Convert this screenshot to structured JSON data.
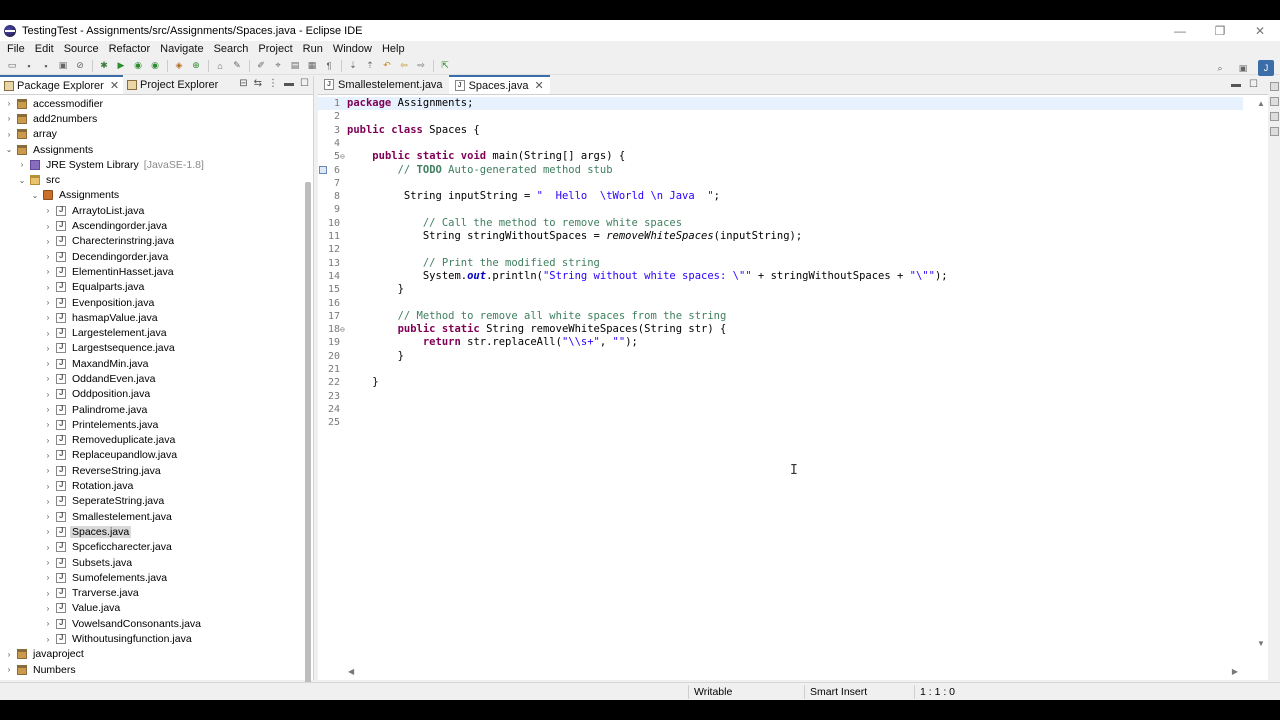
{
  "window": {
    "title": "TestingTest - Assignments/src/Assignments/Spaces.java - Eclipse IDE",
    "controls": {
      "minimize": "—",
      "restore": "❐",
      "close": "✕"
    }
  },
  "menu": [
    "File",
    "Edit",
    "Source",
    "Refactor",
    "Navigate",
    "Search",
    "Project",
    "Run",
    "Window",
    "Help"
  ],
  "left_pane": {
    "tabs": [
      {
        "label": "Package Explorer",
        "active": true
      },
      {
        "label": "Project Explorer",
        "active": false
      }
    ],
    "tree": [
      {
        "label": "accessmodifier",
        "depth": 0,
        "icon": "project-icon",
        "toggle": "›"
      },
      {
        "label": "add2numbers",
        "depth": 0,
        "icon": "project-icon",
        "toggle": "›"
      },
      {
        "label": "array",
        "depth": 0,
        "icon": "project-icon",
        "toggle": "›"
      },
      {
        "label": "Assignments",
        "depth": 0,
        "icon": "project-icon",
        "toggle": "⌄"
      },
      {
        "label": "JRE System Library",
        "extra": "[JavaSE-1.8]",
        "depth": 1,
        "icon": "library-icon",
        "toggle": "›"
      },
      {
        "label": "src",
        "depth": 1,
        "icon": "folder-icon",
        "toggle": "⌄"
      },
      {
        "label": "Assignments",
        "depth": 2,
        "icon": "package-icon",
        "toggle": "⌄"
      },
      {
        "label": "ArraytoList.java",
        "depth": 3,
        "icon": "java-file-icon",
        "toggle": "›"
      },
      {
        "label": "Ascendingorder.java",
        "depth": 3,
        "icon": "java-file-icon",
        "toggle": "›"
      },
      {
        "label": "Charecterinstring.java",
        "depth": 3,
        "icon": "java-file-icon",
        "toggle": "›"
      },
      {
        "label": "Decendingorder.java",
        "depth": 3,
        "icon": "java-file-icon",
        "toggle": "›"
      },
      {
        "label": "ElementinHasset.java",
        "depth": 3,
        "icon": "java-file-icon",
        "toggle": "›"
      },
      {
        "label": "Equalparts.java",
        "depth": 3,
        "icon": "java-file-icon",
        "toggle": "›"
      },
      {
        "label": "Evenposition.java",
        "depth": 3,
        "icon": "java-file-icon",
        "toggle": "›"
      },
      {
        "label": "hasmapValue.java",
        "depth": 3,
        "icon": "java-file-icon",
        "toggle": "›"
      },
      {
        "label": "Largestelement.java",
        "depth": 3,
        "icon": "java-file-icon",
        "toggle": "›"
      },
      {
        "label": "Largestsequence.java",
        "depth": 3,
        "icon": "java-file-icon",
        "toggle": "›"
      },
      {
        "label": "MaxandMin.java",
        "depth": 3,
        "icon": "java-file-icon",
        "toggle": "›"
      },
      {
        "label": "OddandEven.java",
        "depth": 3,
        "icon": "java-file-icon",
        "toggle": "›"
      },
      {
        "label": "Oddposition.java",
        "depth": 3,
        "icon": "java-file-icon",
        "toggle": "›"
      },
      {
        "label": "Palindrome.java",
        "depth": 3,
        "icon": "java-file-icon",
        "toggle": "›"
      },
      {
        "label": "Printelements.java",
        "depth": 3,
        "icon": "java-file-icon",
        "toggle": "›"
      },
      {
        "label": "Removeduplicate.java",
        "depth": 3,
        "icon": "java-file-icon",
        "toggle": "›"
      },
      {
        "label": "Replaceupandlow.java",
        "depth": 3,
        "icon": "java-file-icon",
        "toggle": "›"
      },
      {
        "label": "ReverseString.java",
        "depth": 3,
        "icon": "java-file-icon",
        "toggle": "›"
      },
      {
        "label": "Rotation.java",
        "depth": 3,
        "icon": "java-file-icon",
        "toggle": "›"
      },
      {
        "label": "SeperateString.java",
        "depth": 3,
        "icon": "java-file-icon",
        "toggle": "›"
      },
      {
        "label": "Smallestelement.java",
        "depth": 3,
        "icon": "java-file-icon",
        "toggle": "›"
      },
      {
        "label": "Spaces.java",
        "depth": 3,
        "icon": "java-file-icon",
        "toggle": "›",
        "selected": true
      },
      {
        "label": "Spceficcharecter.java",
        "depth": 3,
        "icon": "java-file-icon",
        "toggle": "›"
      },
      {
        "label": "Subsets.java",
        "depth": 3,
        "icon": "java-file-icon",
        "toggle": "›"
      },
      {
        "label": "Sumofelements.java",
        "depth": 3,
        "icon": "java-file-icon",
        "toggle": "›"
      },
      {
        "label": "Trarverse.java",
        "depth": 3,
        "icon": "java-file-icon",
        "toggle": "›"
      },
      {
        "label": "Value.java",
        "depth": 3,
        "icon": "java-file-icon",
        "toggle": "›"
      },
      {
        "label": "VowelsandConsonants.java",
        "depth": 3,
        "icon": "java-file-icon",
        "toggle": "›"
      },
      {
        "label": "Withoutusingfunction.java",
        "depth": 3,
        "icon": "java-file-icon",
        "toggle": "›"
      },
      {
        "label": "javaproject",
        "depth": 0,
        "icon": "project-icon",
        "toggle": "›"
      },
      {
        "label": "Numbers",
        "depth": 0,
        "icon": "project-icon",
        "toggle": "›"
      }
    ]
  },
  "editor": {
    "tabs": [
      {
        "label": "Smallestelement.java",
        "active": false
      },
      {
        "label": "Spaces.java",
        "active": true
      }
    ],
    "lines": [
      {
        "n": "1",
        "html": "<span class=\"kw\">package</span> Assignments;"
      },
      {
        "n": "2",
        "html": ""
      },
      {
        "n": "3",
        "html": "<span class=\"kw\">public class</span> Spaces {"
      },
      {
        "n": "4",
        "html": ""
      },
      {
        "n": "5",
        "fold": "⊖",
        "html": "    <span class=\"kw\">public static void</span> main(String[] args) {"
      },
      {
        "n": "6",
        "html": "        <span class=\"cm\">// <b>TODO</b> Auto-generated method stub</span>"
      },
      {
        "n": "7",
        "html": ""
      },
      {
        "n": "8",
        "html": "         String inputString = <span class=\"st\">\"  Hello  \\tWorld \\n Java  \"</span>;"
      },
      {
        "n": "9",
        "html": ""
      },
      {
        "n": "10",
        "html": "            <span class=\"cm\">// Call the method to remove white spaces</span>"
      },
      {
        "n": "11",
        "html": "            String stringWithoutSpaces = <span class=\"it\">removeWhiteSpaces</span>(inputString);"
      },
      {
        "n": "12",
        "html": ""
      },
      {
        "n": "13",
        "html": "            <span class=\"cm\">// Print the modified string</span>"
      },
      {
        "n": "14",
        "html": "            System.<span class=\"fld\">out</span>.println(<span class=\"st\">\"String without white spaces: \\\"\"</span> + stringWithoutSpaces + <span class=\"st\">\"\\\"\"</span>);"
      },
      {
        "n": "15",
        "html": "        }"
      },
      {
        "n": "16",
        "html": ""
      },
      {
        "n": "17",
        "html": "        <span class=\"cm\">// Method to remove all white spaces from the string</span>"
      },
      {
        "n": "18",
        "fold": "⊖",
        "html": "        <span class=\"kw\">public static</span> String removeWhiteSpaces(String str) {"
      },
      {
        "n": "19",
        "html": "            <span class=\"kw\">return</span> str.replaceAll(<span class=\"st\">\"\\\\s+\"</span>, <span class=\"st\">\"\"</span>);"
      },
      {
        "n": "20",
        "html": "        }"
      },
      {
        "n": "21",
        "html": ""
      },
      {
        "n": "22",
        "html": "    }"
      },
      {
        "n": "23",
        "html": ""
      },
      {
        "n": "24",
        "html": ""
      },
      {
        "n": "25",
        "html": ""
      }
    ]
  },
  "status": {
    "writable": "Writable",
    "insert_mode": "Smart Insert",
    "position": "1 : 1 : 0"
  },
  "colors": {
    "keyword": "#7f0055",
    "comment": "#3f7f5f",
    "string": "#2a00ff",
    "accent": "#3b6ea8"
  }
}
